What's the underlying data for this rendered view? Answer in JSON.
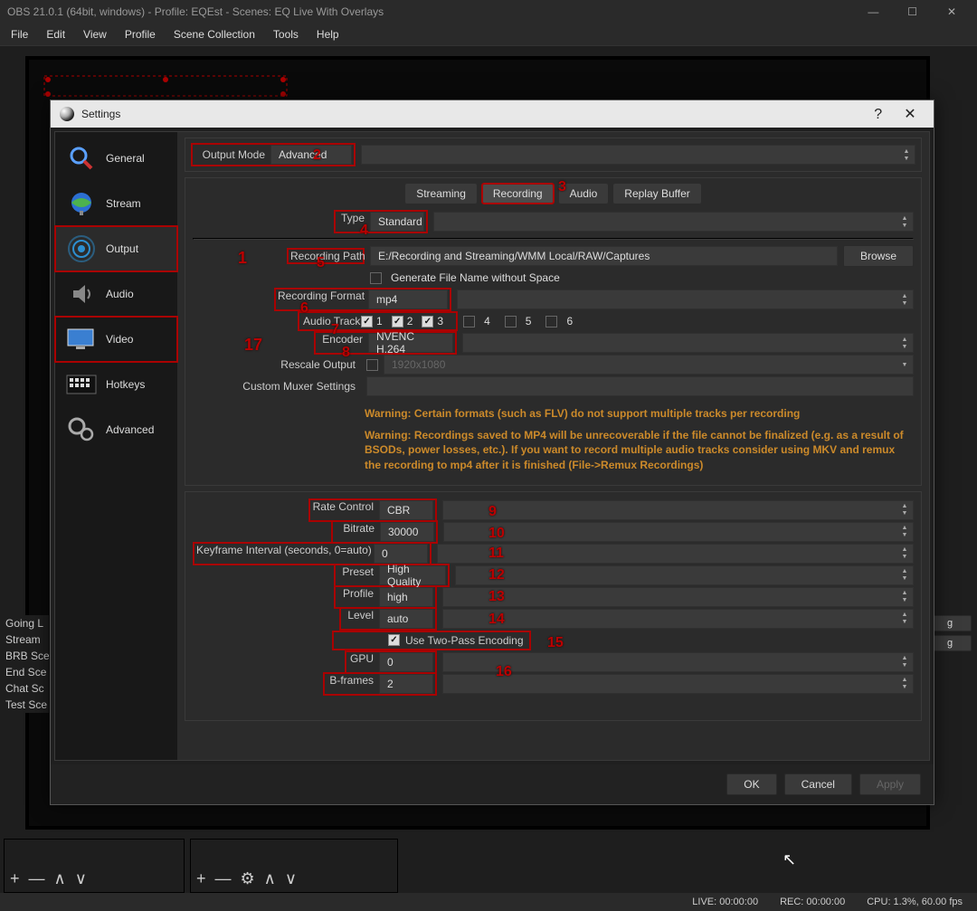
{
  "window": {
    "title": "OBS 21.0.1 (64bit, windows) - Profile: EQEst - Scenes: EQ Live With Overlays",
    "minimize": "—",
    "maximize": "☐",
    "close": "✕"
  },
  "menubar": {
    "file": "File",
    "edit": "Edit",
    "view": "View",
    "profile": "Profile",
    "scene_collection": "Scene Collection",
    "tools": "Tools",
    "help": "Help"
  },
  "scenes": {
    "items": [
      "Going L",
      "Stream",
      "BRB Sce",
      "End Sce",
      "Chat Sc",
      "Test Sce"
    ]
  },
  "panel_buttons": {
    "add": "+",
    "remove": "—",
    "up": "∧",
    "down": "∨",
    "gear": "⚙"
  },
  "statusbar": {
    "live": "LIVE: 00:00:00",
    "rec": "REC: 00:00:00",
    "cpu": "CPU: 1.3%, 60.00 fps"
  },
  "dialog": {
    "title": "Settings",
    "help": "?",
    "close": "✕",
    "ok": "OK",
    "cancel": "Cancel",
    "apply": "Apply"
  },
  "sidebar": {
    "general": "General",
    "stream": "Stream",
    "output": "Output",
    "audio": "Audio",
    "video": "Video",
    "hotkeys": "Hotkeys",
    "advanced": "Advanced"
  },
  "settings": {
    "output_mode_label": "Output Mode",
    "output_mode_value": "Advanced",
    "tabs": {
      "streaming": "Streaming",
      "recording": "Recording",
      "audio": "Audio",
      "replay_buffer": "Replay Buffer"
    },
    "type_label": "Type",
    "type_value": "Standard",
    "rec_path_label": "Recording Path",
    "rec_path_value": "E:/Recording and Streaming/WMM Local/RAW/Captures",
    "browse": "Browse",
    "gen_filename_label": "Generate File Name without Space",
    "rec_format_label": "Recording Format",
    "rec_format_value": "mp4",
    "audio_track_label": "Audio Track",
    "tracks": [
      {
        "label": "1",
        "checked": true
      },
      {
        "label": "2",
        "checked": true
      },
      {
        "label": "3",
        "checked": true
      },
      {
        "label": "4",
        "checked": false
      },
      {
        "label": "5",
        "checked": false
      },
      {
        "label": "6",
        "checked": false
      }
    ],
    "encoder_label": "Encoder",
    "encoder_value": "NVENC H.264",
    "rescale_label": "Rescale Output",
    "rescale_value": "1920x1080",
    "muxer_label": "Custom Muxer Settings",
    "warning1": "Warning: Certain formats (such as FLV) do not support multiple tracks per recording",
    "warning2": "Warning: Recordings saved to MP4 will be unrecoverable if the file cannot be finalized (e.g. as a result of BSODs, power losses, etc.). If you want to record multiple audio tracks consider using MKV and remux the recording to mp4 after it is finished (File->Remux Recordings)",
    "rate_control_label": "Rate Control",
    "rate_control_value": "CBR",
    "bitrate_label": "Bitrate",
    "bitrate_value": "30000",
    "keyframe_label": "Keyframe Interval (seconds, 0=auto)",
    "keyframe_value": "0",
    "preset_label": "Preset",
    "preset_value": "High Quality",
    "profile_label": "Profile",
    "profile_value": "high",
    "level_label": "Level",
    "level_value": "auto",
    "two_pass_label": "Use Two-Pass Encoding",
    "gpu_label": "GPU",
    "gpu_value": "0",
    "bframes_label": "B-frames",
    "bframes_value": "2"
  },
  "annotations": {
    "n1": "1",
    "n2": "2",
    "n3": "3",
    "n4": "4",
    "n5": "5",
    "n6": "6",
    "n7": "7",
    "n8": "8",
    "n9": "9",
    "n10": "10",
    "n11": "11",
    "n12": "12",
    "n13": "13",
    "n14": "14",
    "n15": "15",
    "n16": "16",
    "n17": "17"
  }
}
